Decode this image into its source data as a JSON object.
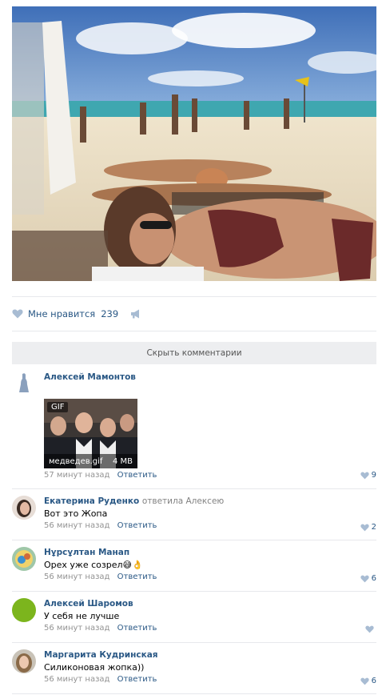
{
  "post": {
    "likes": {
      "label": "Мне нравится",
      "count": "239"
    },
    "hide_comments": "Скрыть комментарии"
  },
  "comments": [
    {
      "author": "Алексей Мамонтов",
      "reply_to": "",
      "text": "",
      "attachment": {
        "badge": "GIF",
        "filename": "медведев.gif",
        "size": "4 MB"
      },
      "time": "57 минут назад",
      "reply_label": "Ответить",
      "likes": "9"
    },
    {
      "author": "Екатерина Руденко",
      "reply_to": "ответила Алексею",
      "text": "Вот это Жопа",
      "time": "56 минут назад",
      "reply_label": "Ответить",
      "likes": "2"
    },
    {
      "author": "Нұрсұлтан Манап",
      "reply_to": "",
      "text": "Орех уже созрел😅👌",
      "time": "56 минут назад",
      "reply_label": "Ответить",
      "likes": "6"
    },
    {
      "author": "Алексей Шаромов",
      "reply_to": "",
      "text": "У себя не лучше",
      "time": "56 минут назад",
      "reply_label": "Ответить",
      "likes": ""
    },
    {
      "author": "Маргарита Кудринская",
      "reply_to": "",
      "text": "Силиконовая жопка))",
      "time": "56 минут назад",
      "reply_label": "Ответить",
      "likes": "6"
    }
  ],
  "icons": [
    "heart-icon",
    "megaphone-icon"
  ],
  "colors": {
    "link": "#2a5885",
    "muted": "#939393",
    "bar": "#edeef0"
  }
}
